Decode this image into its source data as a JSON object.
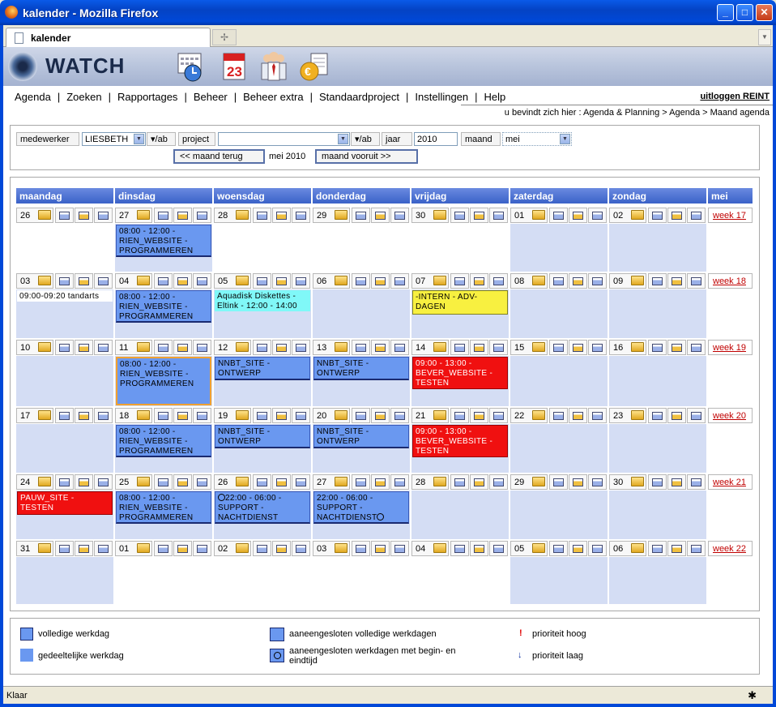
{
  "window": {
    "title": "kalender - Mozilla Firefox",
    "tab": "kalender",
    "status": "Klaar"
  },
  "app": {
    "logo": "WATCH",
    "logout": "uitloggen REINT",
    "breadcrumb": "u bevindt zich hier : Agenda & Planning > Agenda > Maand agenda"
  },
  "nav": [
    "Agenda",
    "Zoeken",
    "Rapportages",
    "Beheer",
    "Beheer extra",
    "Standaardproject",
    "Instellingen",
    "Help"
  ],
  "filters": {
    "medewerker_label": "medewerker",
    "medewerker_value": "LIESBETH",
    "ab_label": "▾/ab",
    "project_label": "project",
    "project_value": "",
    "jaar_label": "jaar",
    "jaar_value": "2010",
    "maand_label": "maand",
    "maand_value": "mei",
    "prev": "<< maand terug",
    "current": "mei 2010",
    "next": "maand vooruit >>"
  },
  "calendar": {
    "headers": [
      "maandag",
      "dinsdag",
      "woensdag",
      "donderdag",
      "vrijdag",
      "zaterdag",
      "zondag",
      "mei"
    ],
    "weeks": [
      {
        "days": [
          "26",
          "27",
          "28",
          "29",
          "30",
          "01",
          "02"
        ],
        "week": "week 17",
        "events": [
          {
            "col": 1,
            "type": "blue",
            "text": "08:00 - 12:00 - RIEN_WEBSITE - PROGRAMMEREN"
          }
        ]
      },
      {
        "days": [
          "03",
          "04",
          "05",
          "06",
          "07",
          "08",
          "09"
        ],
        "week": "week 18",
        "events": [
          {
            "col": 0,
            "type": "plain",
            "text": "09:00-09:20 tandarts"
          },
          {
            "col": 1,
            "type": "blue",
            "text": "08:00 - 12:00 - RIEN_WEBSITE - PROGRAMMEREN"
          },
          {
            "col": 2,
            "type": "cyan",
            "text": "Aquadisk Diskettes - Eltink - 12:00 - 14:00"
          },
          {
            "col": 4,
            "type": "yellow",
            "text": "-INTERN - ADV-DAGEN"
          }
        ]
      },
      {
        "days": [
          "10",
          "11",
          "12",
          "13",
          "14",
          "15",
          "16"
        ],
        "week": "week 19",
        "events": [
          {
            "col": 1,
            "type": "blue sel",
            "text": "08:00 - 12:00 - RIEN_WEBSITE - PROGRAMMEREN"
          },
          {
            "col": 2,
            "type": "blue",
            "text": "NNBT_SITE - ONTWERP"
          },
          {
            "col": 3,
            "type": "blue",
            "text": "NNBT_SITE - ONTWERP"
          },
          {
            "col": 4,
            "type": "red",
            "text": "09:00 - 13:00 - BEVER_WEBSITE - TESTEN"
          }
        ]
      },
      {
        "days": [
          "17",
          "18",
          "19",
          "20",
          "21",
          "22",
          "23"
        ],
        "week": "week 20",
        "events": [
          {
            "col": 1,
            "type": "blue",
            "text": "08:00 - 12:00 - RIEN_WEBSITE - PROGRAMMEREN"
          },
          {
            "col": 2,
            "type": "blue",
            "text": "NNBT_SITE - ONTWERP"
          },
          {
            "col": 3,
            "type": "blue",
            "text": "NNBT_SITE - ONTWERP"
          },
          {
            "col": 4,
            "type": "red",
            "text": "09:00 - 13:00 - BEVER_WEBSITE - TESTEN"
          }
        ]
      },
      {
        "days": [
          "24",
          "25",
          "26",
          "27",
          "28",
          "29",
          "30"
        ],
        "week": "week 21",
        "events": [
          {
            "col": 0,
            "type": "red",
            "text": "PAUW_SITE - TESTEN"
          },
          {
            "col": 1,
            "type": "blue",
            "text": "08:00 - 12:00 - RIEN_WEBSITE - PROGRAMMEREN"
          },
          {
            "col": 2,
            "type": "blue",
            "text": "22:00 - 06:00 - SUPPORT - NACHTDIENST",
            "clock": "start"
          },
          {
            "col": 3,
            "type": "blue",
            "text": "22:00 - 06:00 - SUPPORT - NACHTDIENST",
            "clock": "end"
          }
        ]
      },
      {
        "days": [
          "31",
          "01",
          "02",
          "03",
          "04",
          "05",
          "06"
        ],
        "week": "week 22",
        "events": []
      }
    ]
  },
  "legend": {
    "volledig": "volledige werkdag",
    "gedeeltelijk": "gedeeltelijke werkdag",
    "aaneen_volledig": "aaneengesloten volledige werkdagen",
    "aaneen_tijd": "aaneengesloten werkdagen met begin- en eindtijd",
    "prio_hoog": "prioriteit hoog",
    "prio_laag": "prioriteit laag",
    "prio_hoog_icon": "!",
    "prio_laag_icon": "↓"
  },
  "colors": {
    "blue": "#6a98f0",
    "red": "#f01010",
    "yellow": "#f8f040",
    "cyan": "#80f8f8",
    "cellbg": "#d4ddf4",
    "header": "#3a62c8"
  }
}
